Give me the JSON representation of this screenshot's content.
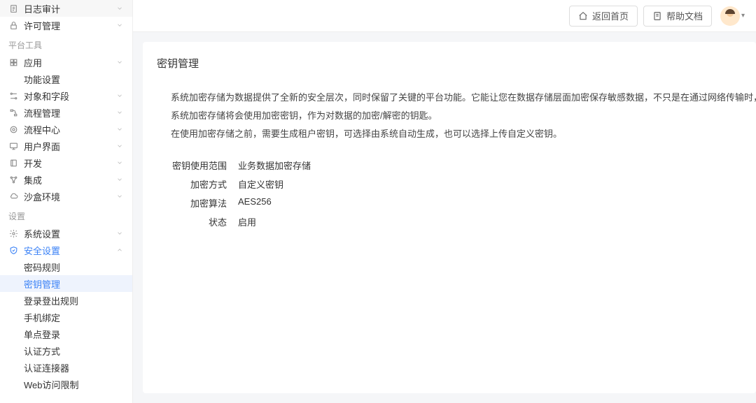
{
  "header": {
    "back_home": "返回首页",
    "help_docs": "帮助文档"
  },
  "sidebar": {
    "top_items": [
      {
        "label": "日志审计",
        "icon": "notepad-icon",
        "expandable": true
      },
      {
        "label": "许可管理",
        "icon": "lock-icon",
        "expandable": true
      }
    ],
    "group_platform": "平台工具",
    "platform_items": [
      {
        "label": "应用",
        "icon": "grid-icon",
        "expandable": true
      },
      {
        "label": "功能设置",
        "icon": "",
        "expandable": false,
        "sub": true
      },
      {
        "label": "对象和字段",
        "icon": "field-icon",
        "expandable": true
      },
      {
        "label": "流程管理",
        "icon": "flow-icon",
        "expandable": true
      },
      {
        "label": "流程中心",
        "icon": "target-icon",
        "expandable": true
      },
      {
        "label": "用户界面",
        "icon": "monitor-icon",
        "expandable": true
      },
      {
        "label": "开发",
        "icon": "book-icon",
        "expandable": true
      },
      {
        "label": "集成",
        "icon": "nodes-icon",
        "expandable": true
      },
      {
        "label": "沙盒环境",
        "icon": "cloud-icon",
        "expandable": true
      }
    ],
    "group_settings": "设置",
    "settings_items": [
      {
        "label": "系统设置",
        "icon": "gear-icon",
        "expandable": true,
        "expanded": false
      },
      {
        "label": "安全设置",
        "icon": "shield-icon",
        "expandable": true,
        "expanded": true,
        "active": true
      }
    ],
    "security_children": [
      {
        "label": "密码规则"
      },
      {
        "label": "密钥管理",
        "active": true
      },
      {
        "label": "登录登出规则"
      },
      {
        "label": "手机绑定"
      },
      {
        "label": "单点登录"
      },
      {
        "label": "认证方式"
      },
      {
        "label": "认证连接器"
      },
      {
        "label": "Web访问限制"
      }
    ]
  },
  "page": {
    "title": "密钥管理",
    "desc1": "系统加密存储为数据提供了全新的安全层次，同时保留了关键的平台功能。它能让您在数据存储层面加密保存敏感数据，不只是在通过网络传输时，以便贵公司满足隐私政策、法规要求。以及处理私人数据方面",
    "desc2": "系统加密存储将会使用加密密钥，作为对数据的加密/解密的钥匙。",
    "desc3": "在使用加密存储之前，需要生成租户密钥，可选择由系统自动生成，也可以选择上传自定义密钥。",
    "fields": [
      {
        "key": "密钥使用范围",
        "value": "业务数据加密存储"
      },
      {
        "key": "加密方式",
        "value": "自定义密钥"
      },
      {
        "key": "加密算法",
        "value": "AES256"
      },
      {
        "key": "状态",
        "value": "启用"
      }
    ]
  }
}
